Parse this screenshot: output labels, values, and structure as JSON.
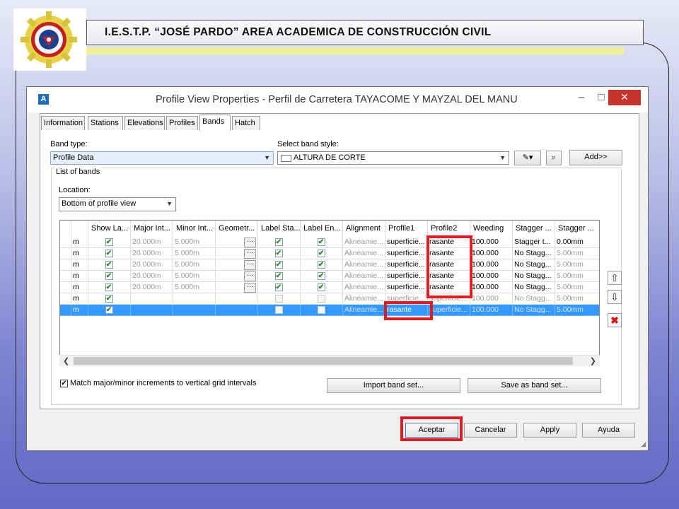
{
  "header": {
    "title": "I.E.S.T.P. “JOSÉ PARDO” AREA ACADEMICA DE CONSTRUCCIÓN CIVIL"
  },
  "dialog": {
    "title": "Profile View Properties - Perfil de Carretera TAYACOME Y MAYZAL DEL MANU",
    "app_icon": "A",
    "min_glyph": "–",
    "max_glyph": "□",
    "close_glyph": "✕",
    "tabs": [
      "Information",
      "Stations",
      "Elevations",
      "Profiles",
      "Bands",
      "Hatch"
    ],
    "active_tab": "Bands",
    "band_type_label": "Band type:",
    "band_type_value": "Profile Data",
    "select_style_label": "Select band style:",
    "select_style_value": "ALTURA DE CORTE",
    "add_button": "Add>>",
    "list_label": "List of bands",
    "location_label": "Location:",
    "location_value": "Bottom of profile view",
    "columns": [
      "",
      "Show La...",
      "Major Int...",
      "Minor Int...",
      "Geometr...",
      "Label Sta...",
      "Label En...",
      "Alignment",
      "Profile1",
      "Profile2",
      "Weeding",
      "Stagger ...",
      "Stagger ..."
    ],
    "rows": [
      {
        "c0": "m",
        "show": true,
        "major": "20.000m",
        "minor": "5.000m",
        "geo": true,
        "lsta": true,
        "lend": true,
        "align": "Alineamie...",
        "p1": "superficie...",
        "p2": "rasante",
        "weed": "100.000",
        "st1": "Stagger t...",
        "st2": "0.00mm"
      },
      {
        "c0": "m",
        "show": true,
        "major": "20.000m",
        "minor": "5.000m",
        "geo": true,
        "lsta": true,
        "lend": true,
        "align": "Alineamie...",
        "p1": "superficie...",
        "p2": "rasante",
        "weed": "100.000",
        "st1": "No Stagg...",
        "st2": "5.00mm"
      },
      {
        "c0": "m",
        "show": true,
        "major": "20.000m",
        "minor": "5.000m",
        "geo": true,
        "lsta": true,
        "lend": true,
        "align": "Alineamie...",
        "p1": "superficie...",
        "p2": "rasante",
        "weed": "100.000",
        "st1": "No Stagg...",
        "st2": "5.00mm"
      },
      {
        "c0": "m",
        "show": true,
        "major": "20.000m",
        "minor": "5.000m",
        "geo": true,
        "lsta": true,
        "lend": true,
        "align": "Alineamie...",
        "p1": "superficie...",
        "p2": "rasante",
        "weed": "100.000",
        "st1": "No Stagg...",
        "st2": "5.00mm"
      },
      {
        "c0": "m",
        "show": true,
        "major": "20.000m",
        "minor": "5.000m",
        "geo": true,
        "lsta": true,
        "lend": true,
        "align": "Alineamie...",
        "p1": "superficie...",
        "p2": "rasante",
        "weed": "100.000",
        "st1": "No Stagg...",
        "st2": "5.00mm"
      },
      {
        "c0": "m",
        "show": true,
        "major": "",
        "minor": "",
        "geo": false,
        "lsta": false,
        "lend": false,
        "align": "Alineamie...",
        "p1": "superficie...",
        "p2": "superficie...",
        "weed": "100.000",
        "st1": "No Stagg...",
        "st2": "5.00mm"
      },
      {
        "c0": "m",
        "show": true,
        "major": "",
        "minor": "",
        "geo": false,
        "lsta": false,
        "lend": false,
        "align": "Alineamie...",
        "p1": "rasante",
        "p2": "superficie...",
        "weed": "100.000",
        "st1": "No Stagg...",
        "st2": "5.00mm"
      }
    ],
    "selected_row": 6,
    "match_checkbox_label": "Match major/minor increments to vertical grid intervals",
    "match_checked": true,
    "import_button": "Import band set...",
    "save_button": "Save as band set...",
    "ok_button": "Aceptar",
    "cancel_button": "Cancelar",
    "apply_button": "Apply",
    "help_button": "Ayuda",
    "highlight_color": "#e01b24",
    "selection_color": "#3399ff"
  }
}
